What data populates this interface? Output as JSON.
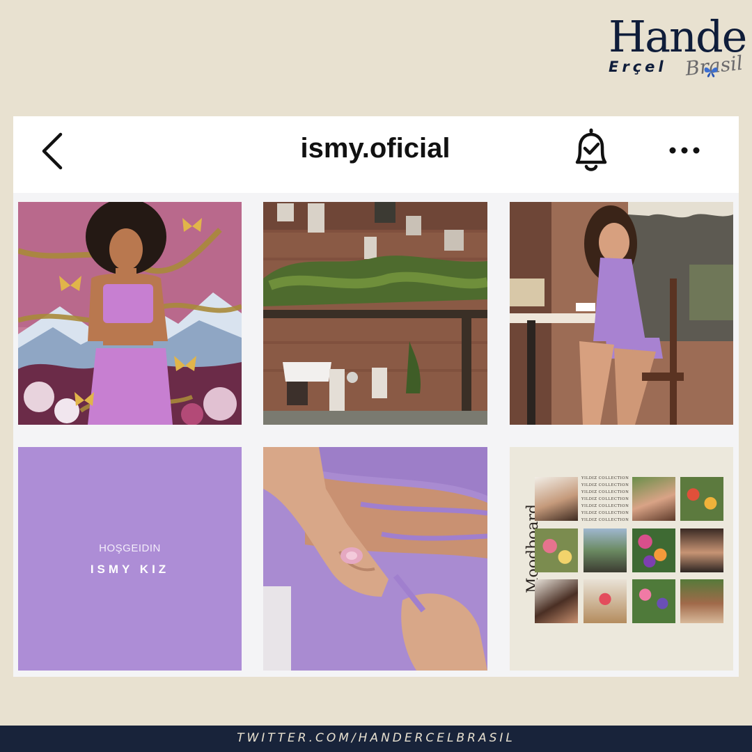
{
  "brand": {
    "name": "Hande",
    "surname": "Erçel",
    "script": "Brasil"
  },
  "profile": {
    "username": "ismy.oficial"
  },
  "posts": {
    "welcome": {
      "line1": "HOŞGEIDIN",
      "line2": "ISMY KIZ"
    },
    "moodboard": {
      "title": "Moodboard",
      "list": [
        "YILDIZ COLLECTION",
        "YILDIZ COLLECTION",
        "YILDIZ COLLECTION",
        "YILDIZ COLLECTION",
        "YILDIZ COLLECTION",
        "YILDIZ COLLECTION",
        "YILDIZ COLLECTION"
      ]
    }
  },
  "footer": {
    "text": "TWITTER.COM/HANDERCELBRASIL"
  },
  "colors": {
    "background": "#e8e1d0",
    "footer": "#18233a",
    "lavender": "#ad8dd6",
    "brand_navy": "#0f1d3a"
  }
}
